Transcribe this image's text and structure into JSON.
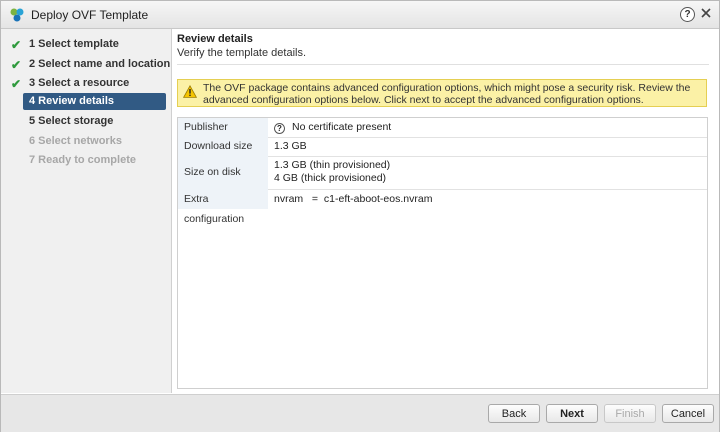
{
  "window": {
    "title": "Deploy OVF Template",
    "help_label": "?"
  },
  "steps": [
    {
      "label": "1  Select template",
      "state": "done"
    },
    {
      "label": "2  Select name and location",
      "state": "done"
    },
    {
      "label": "3  Select a resource",
      "state": "done"
    },
    {
      "label": "4  Review details",
      "state": "active"
    },
    {
      "label": "5  Select storage",
      "state": "pending"
    },
    {
      "label": "6  Select networks",
      "state": "disabled"
    },
    {
      "label": "7  Ready to complete",
      "state": "disabled"
    }
  ],
  "main": {
    "title": "Review details",
    "subtitle": "Verify the template details.",
    "warning": "The OVF package contains advanced configuration options, which might pose a security risk. Review the advanced configuration options below. Click next to accept the advanced configuration options.",
    "details": [
      {
        "key": "Publisher",
        "values": [
          "No certificate present"
        ],
        "icon": "question-icon"
      },
      {
        "key": "Download size",
        "values": [
          "1.3 GB"
        ]
      },
      {
        "key": "Size on disk",
        "values": [
          "1.3 GB (thin provisioned)",
          "4 GB (thick provisioned)"
        ]
      },
      {
        "key": "Extra configuration",
        "values": [
          "nvram   =  c1-eft-aboot-eos.nvram"
        ]
      }
    ]
  },
  "footer": {
    "back": "Back",
    "next": "Next",
    "finish": "Finish",
    "cancel": "Cancel"
  },
  "colors": {
    "active_step": "#315a84",
    "check": "#2f9a3d",
    "warning_bg": "#fbf1a6",
    "key_bg": "#eef3f8"
  }
}
